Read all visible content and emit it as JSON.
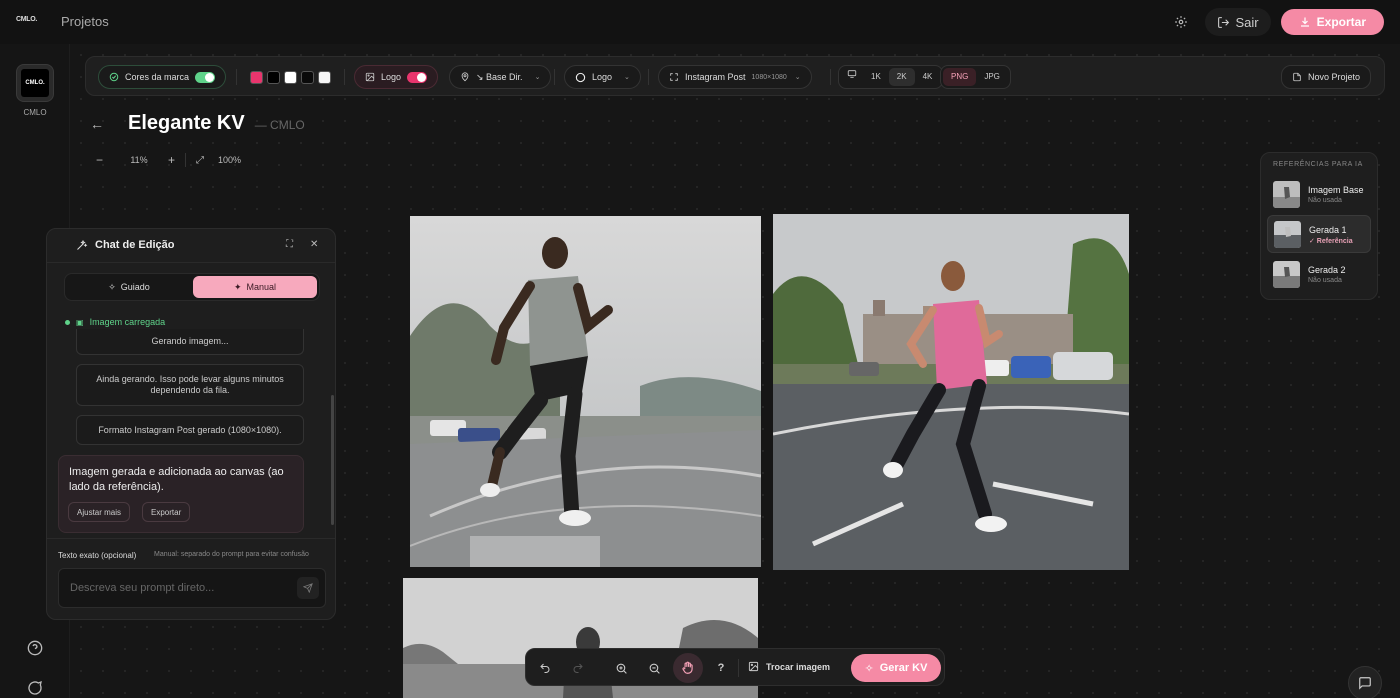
{
  "app": {
    "brand_logo_text": "CMLO.",
    "nav_projects": "Projetos",
    "logout_label": "Sair",
    "export_label": "Exportar"
  },
  "workspace": {
    "avatar_text": "CMLO.",
    "label": "CMLO"
  },
  "toolbar": {
    "brand_colors_label": "Cores da marca",
    "brand_colors_enabled": true,
    "swatches": [
      "#e8356d",
      "#000000",
      "#ffffff",
      "#0a0a0a",
      "#f5f5f5"
    ],
    "logo_toggle_label": "Logo",
    "logo_enabled": true,
    "position_label": "↘ Base Dir.",
    "logo_select_label": "Logo",
    "format_label": "Instagram Post",
    "format_size": "1080×1080",
    "resolutions": [
      "1K",
      "2K",
      "4K"
    ],
    "resolution_selected": "2K",
    "file_types": [
      "PNG",
      "JPG"
    ],
    "file_type_selected": "PNG",
    "new_project_label": "Novo Projeto"
  },
  "project": {
    "title": "Elegante KV",
    "subtitle": "— CMLO"
  },
  "zoom": {
    "level": "11%",
    "fit_label": "100%"
  },
  "chat": {
    "title": "Chat de Edição",
    "mode_guided": "Guiado",
    "mode_manual": "Manual",
    "mode_selected": "Manual",
    "status": "Imagem carregada",
    "messages": [
      "Gerando imagem...",
      "Ainda gerando. Isso pode levar alguns minutos dependendo da fila.",
      "Formato Instagram Post gerado (1080×1080)."
    ],
    "final_message": "Imagem gerada e adicionada ao canvas (ao lado da referência).",
    "action_adjust": "Ajustar mais",
    "action_export": "Exportar",
    "exact_text_label": "Texto exato (opcional)",
    "exact_text_note": "Manual: separado do prompt para evitar confusão",
    "prompt_placeholder": "Descreva seu prompt direto..."
  },
  "references": {
    "title": "REFERÊNCIAS PARA IA",
    "items": [
      {
        "name": "Imagem Base",
        "status": "Não usada"
      },
      {
        "name": "Gerada 1",
        "status": "✓ Referência"
      },
      {
        "name": "Gerada 2",
        "status": "Não usada"
      }
    ]
  },
  "bottombar": {
    "help_label": "?",
    "swap_image_label": "Trocar imagem",
    "generate_label": "Gerar KV"
  },
  "colors": {
    "accent": "#f58aa5",
    "success": "#5fd38a",
    "background": "#141414"
  }
}
